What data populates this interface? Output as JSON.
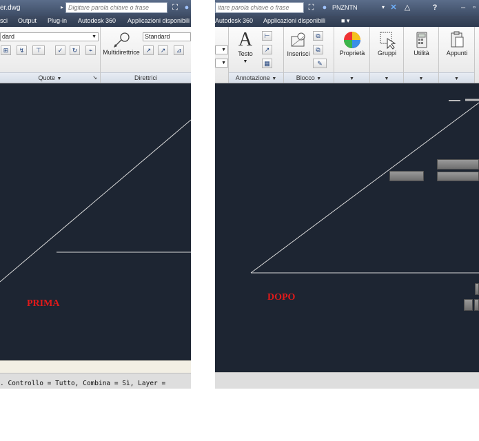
{
  "left": {
    "title": "er.dwg",
    "search_placeholder": "Digitare parola chiave o frase",
    "tabs": [
      "sci",
      "Output",
      "Plug-in",
      "Autodesk 360",
      "Applicazioni disponibili"
    ],
    "style_combo": "dard",
    "style_combo2": "Standard",
    "multileader_label": "Multidirettrice",
    "group_quote": "Quote",
    "group_direttrici": "Direttrici",
    "canvas_label": "PRIMA",
    "command_text": ". Controllo = Tutto, Combina = Sì, Layer ="
  },
  "right": {
    "search_placeholder": "itare parola chiave o frase",
    "user_name": "PNZNTN",
    "tabs": [
      "Autodesk 360",
      "Applicazioni disponibili"
    ],
    "buttons": {
      "testo": "Testo",
      "inserisci": "Inserisci",
      "proprieta": "Proprietà",
      "gruppi": "Gruppi",
      "utilita": "Utilità",
      "appunti": "Appunti"
    },
    "group_annotazione": "Annotazione",
    "group_blocco": "Blocco",
    "canvas_label": "DOPO"
  },
  "colors": {
    "canvas": "#1d2532",
    "label_red": "#e01a1a",
    "line": "#d9d9d9"
  }
}
